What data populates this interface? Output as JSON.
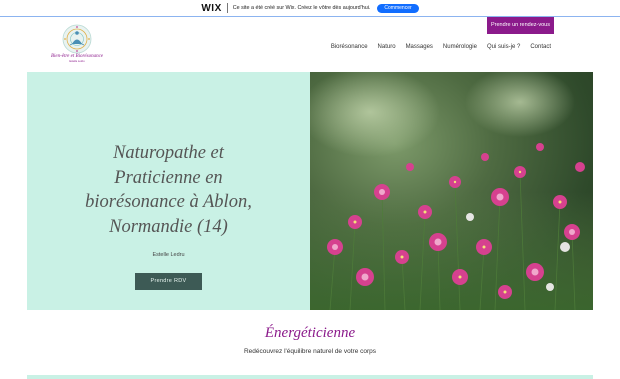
{
  "wix_banner": {
    "logo": "WIX",
    "text": "Ce site a été créé sur Wix. Créez le vôtre dès aujourd'hui.",
    "cta": "Commencer"
  },
  "header": {
    "book_button": "Prendre un rendez-vous",
    "logo": {
      "title": "Bien-être et Biorésonance",
      "subtitle": "Estelle Ledru"
    },
    "nav": [
      "Biorésonance",
      "Naturo",
      "Massages",
      "Numérologie",
      "Qui suis-je ?",
      "Contact"
    ]
  },
  "hero": {
    "title_lines": [
      "Naturopathe et",
      "Praticienne en",
      "biorésonance à Ablon,",
      "Normandie (14)"
    ],
    "name": "Estelle Ledru",
    "cta": "Prendre RDV",
    "image_icon": "pink-cosmos-flowers-photo"
  },
  "section": {
    "title": "Énergéticienne",
    "subtitle": "Redécouvrez l'équilibre naturel de votre corps"
  },
  "colors": {
    "wix_blue": "#116dff",
    "brand_purple": "#8b1a8b",
    "mint": "#c9f1e5",
    "cta_dark": "#3d5a55"
  }
}
